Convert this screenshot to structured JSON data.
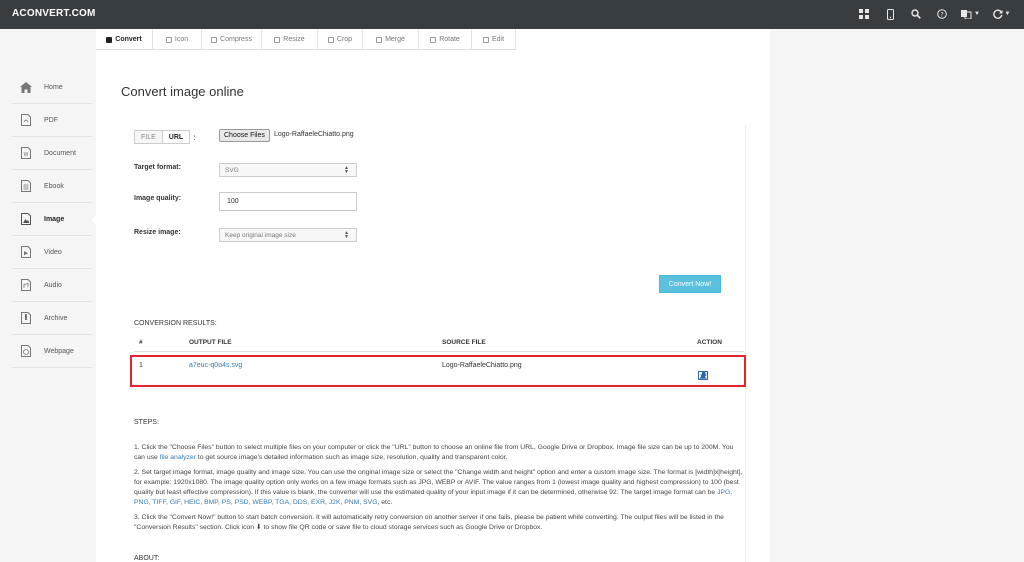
{
  "brand": "ACONVERT.COM",
  "navbar": {
    "icons": [
      "grid-icon",
      "mobile-icon",
      "search-icon",
      "help-icon",
      "language-icon",
      "refresh-icon"
    ]
  },
  "sidebar": {
    "items": [
      {
        "label": "Home",
        "icon": "home-icon"
      },
      {
        "label": "PDF",
        "icon": "pdf-icon"
      },
      {
        "label": "Document",
        "icon": "document-icon"
      },
      {
        "label": "Ebook",
        "icon": "ebook-icon"
      },
      {
        "label": "Image",
        "icon": "image-icon",
        "active": true
      },
      {
        "label": "Video",
        "icon": "video-icon"
      },
      {
        "label": "Audio",
        "icon": "audio-icon"
      },
      {
        "label": "Archive",
        "icon": "archive-icon"
      },
      {
        "label": "Webpage",
        "icon": "webpage-icon"
      }
    ]
  },
  "tabs": [
    "Convert",
    "Icon",
    "Compress",
    "Resize",
    "Crop",
    "Merge",
    "Rotate",
    "Edit"
  ],
  "page_title": "Convert image online",
  "form": {
    "file_label": "FILE",
    "url_label": "URL",
    "colon": ":",
    "choose_button": "Choose Files",
    "file_name": "Logo-RaffaeleChiatto.png",
    "target_format_label": "Target format:",
    "target_format_value": "SVG",
    "quality_label": "Image quality:",
    "quality_value": "100",
    "resize_label": "Resize image:",
    "resize_value": "Keep original image size",
    "convert_button": "Convert Now!"
  },
  "results": {
    "title": "CONVERSION RESULTS:",
    "headers": [
      "#",
      "OUTPUT FILE",
      "SOURCE FILE",
      "ACTION"
    ],
    "rows": [
      {
        "num": "1",
        "output": "a7euc-q0o4s.svg",
        "source": "Logo-RaffaeleChiatto.png"
      }
    ]
  },
  "steps": {
    "title": "STEPS:",
    "step1_a": "1. Click the \"Choose Files\" button to select multiple files on your computer or click the \"URL\" button to choose an online file from URL, Google Drive or Dropbox. Image file size can be up to 200M. You can use ",
    "step1_link": "file analyzer",
    "step1_b": " to get source image's detailed information such as image size, resolution, quality and transparent color.",
    "step2": "2. Set target image format, image quality and image size. You can use the original image size or select the \"Change width and height\" option and enter a custom image size. The format is [width]x[height], for example: 1920x1080. The image quality option only works on a few image formats such as JPG, WEBP or AVIF. The value ranges from 1 (lowest image quality and highest compression) to 100 (best quality but least effective compression). If this value is blank, the converter will use the estimated quality of your input image if it can be determined, otherwise 92. The target image format can be ",
    "step2_formats": "JPG, PNG, TIFF, GIF, HEIC, BMP, PS, PSD, WEBP, TGA, DDS, EXR, J2K, PNM, SVG",
    "step2_end": ", etc.",
    "step3": "3. Click the \"Convert Now!\" button to start batch conversion. It will automatically retry conversion on another server if one fails, please be patient while converting. The output files will be listed in the \"Conversion Results\" section. Click icon ⬇ to show file QR code or save file to cloud storage services such as Google Drive or Dropbox."
  },
  "about_title": "ABOUT:"
}
